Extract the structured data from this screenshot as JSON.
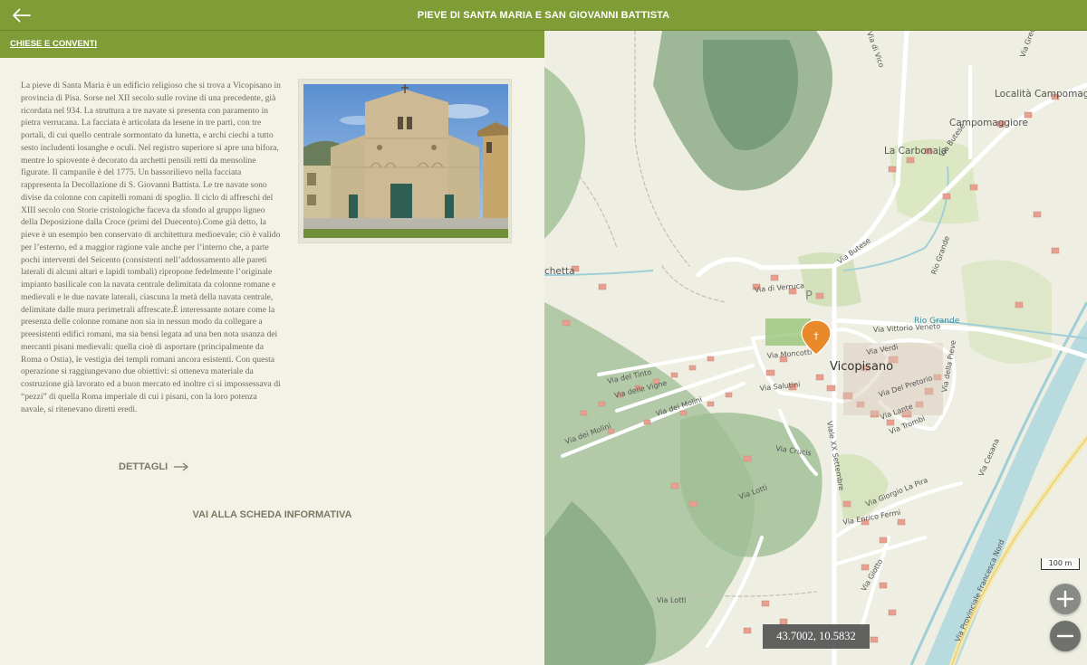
{
  "header": {
    "title": "PIEVE DI SANTA MARIA E SAN GIOVANNI BATTISTA",
    "back_icon": "arrow-left-icon"
  },
  "category": {
    "label": "CHIESE E CONVENTI"
  },
  "content": {
    "description": "La pieve di Santa Maria è un edificio religioso che si trova a Vicopisano in provincia di Pisa. Sorse nel XII secolo sulle rovine di una precedente, già ricordata nel 934. La struttura a tre navate si presenta con paramento in pietra verrucana. La facciata è articolata da lesene in tre parti, con tre portali, di cui quello centrale sormontato da lunetta, e archi ciechi a tutto sesto includenti losanghe e oculi. Nel registro superiore si apre una bifora, mentre lo spiovente è decorato da archetti pensili retti da mensoline figurate. Il campanile è del 1775. Un bassorilievo nella facciata rappresenta la Decollazione di S. Giovanni Battista. Le tre navate sono divise da colonne con capitelli romani di spoglio. Il ciclo di affreschi del XIII secolo con Storie cristologiche faceva da sfondo al gruppo ligneo della Deposizione dalla Croce (primi del Duecento).Come già detto, la pieve è un esempio ben conservato di architettura medioevale; ciò è valido per l’esterno, ed a maggior ragione vale anche per l’interno che, a parte pochi interventi del Seicento (consistenti nell’addossamento alle pareti laterali di alcuni altari e lapidi tombali) ripropone fedelmente l’originale impianto basilicale con la navata centrale delimitata da colonne romane e medievali e le due navate laterali, ciascuna la metà della navata centrale, delimitate dalle mura perimetrali affrescate.È interessante notare come la presenza delle colonne romane non sia in nessun modo da collegare a preesistenti edifici romani, ma sia bensì legata ad una ben nota usanza dei mercanti pisani medievali: quella cioè di asportare (principalmente da Roma o Ostia), le vestigia dei templi romani ancora esistenti. Con questa operazione si raggiungevano due obiettivi: si otteneva materiale da costruzione già lavorato ed a buon mercato ed inoltre ci si impossessava di “pezzi” di quella Roma imperiale di cui i pisani, con la loro potenza navale, si ritenevano diretti eredi.",
    "details_label": "DETTAGLI",
    "details_icon": "arrow-right-icon",
    "info_link_label": "VAI ALLA SCHEDA INFORMATIVA"
  },
  "map": {
    "place_labels": {
      "vicopisano": "Vicopisano",
      "carbonaia": "La Carbonaia",
      "campomaggiore": "Campomaggiore",
      "localita": "Località Campomaggiore",
      "chetta": "chetta",
      "rio_grande": "Rio Grande",
      "rio_grande_v": "Rio Grande",
      "parking": "P"
    },
    "street_labels": {
      "via_butese": "Via Butese",
      "via_butese_2": "Via Butese",
      "via_di_verruca": "Via di Verruca",
      "via_vittorio_veneto": "Via Vittorio Veneto",
      "via_verdi": "Via Verdi",
      "via_moncotti": "Via Moncotti",
      "via_del_tinto": "Via del Tinto",
      "via_delle_vigne": "Via delle Vigne",
      "via_salutini": "Via Salutini",
      "via_dei_molini": "Via dei Molini",
      "via_del_pretorio": "Via Del Pretorio",
      "via_lante": "Via Lante",
      "via_trombi": "Via Trombi",
      "via_crucis": "Via Crucis",
      "viale_xx_settembre": "Viale XX Settembre",
      "via_lotti": "Via Lotti",
      "via_lotti_2": "Via Lotti",
      "via_giorgio_la_pira": "Via Giorgio La Pira",
      "via_enrico_fermi": "Via Enrico Fermi",
      "via_giotto": "Via Giotto",
      "via_provinciale": "Via Provinciale Francesca Nord",
      "via_cesana": "Via Cesana",
      "via_della_pieve": "Via della Pieve",
      "via_di_vico": "Via di Vico",
      "via_greci": "Via Greci"
    },
    "scale_label": "100 m",
    "coordinates": "43.7002, 10.5832",
    "marker_icon": "map-pin-icon",
    "zoom_in_icon": "plus-icon",
    "zoom_out_icon": "minus-icon"
  },
  "colors": {
    "header": "#7f9c36",
    "panel_bg": "#f3f2e6",
    "text": "#6a6a58",
    "marker": "#e8892a"
  }
}
